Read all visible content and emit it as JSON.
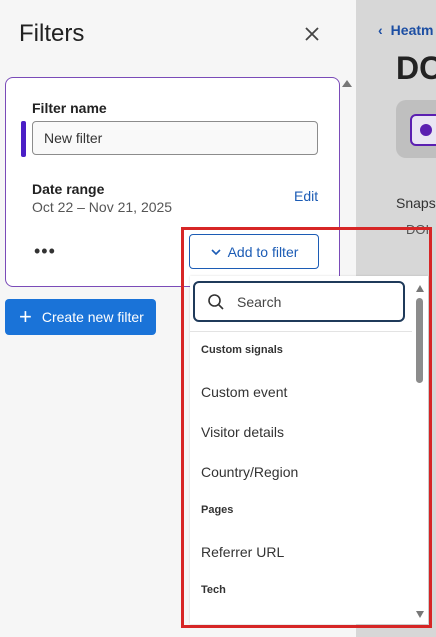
{
  "panel": {
    "title": "Filters",
    "close_icon": "close-icon"
  },
  "background": {
    "breadcrumb": "Heatm",
    "heading": "DC",
    "snapshot_text": "Snaps",
    "do_text": "DOI"
  },
  "filter_card": {
    "name_label": "Filter name",
    "name_value": "New filter",
    "date_label": "Date range",
    "date_value": "Oct 22 – Nov 21, 2025",
    "edit_label": "Edit",
    "more_label": "•••",
    "accent_color": "#4b1fc6"
  },
  "add_to_filter": {
    "label": "Add to filter",
    "icon": "chevron-down-icon"
  },
  "create_button": {
    "label": "Create new filter",
    "icon": "plus-icon",
    "color": "#1a73d8"
  },
  "dropdown": {
    "search_placeholder": "Search",
    "groups": [
      {
        "label": "Custom signals",
        "items": [
          "Custom event",
          "Visitor details",
          "Country/Region"
        ]
      },
      {
        "label": "Pages",
        "items": [
          "Referrer URL"
        ]
      },
      {
        "label": "Tech",
        "items": []
      }
    ]
  },
  "highlight_color": "#d72626"
}
